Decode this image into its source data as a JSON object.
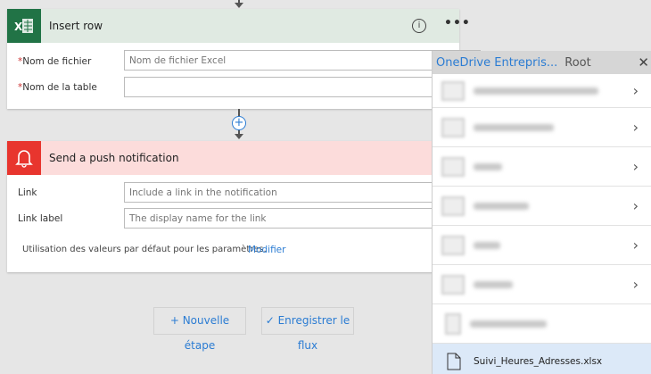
{
  "insert_row": {
    "title": "Insert row",
    "fields": [
      {
        "label": "Nom de fichier",
        "required": true,
        "placeholder": "Nom de fichier Excel"
      },
      {
        "label": "Nom de la table",
        "required": true,
        "placeholder": ""
      }
    ]
  },
  "push": {
    "title": "Send a push notification",
    "fields": [
      {
        "label": "Link",
        "placeholder": "Include a link in the notification"
      },
      {
        "label": "Link label",
        "placeholder": "The display name for the link"
      }
    ],
    "defaults_text": "Utilisation des valeurs par défaut pour les paramètres.",
    "modify_link": "Modifier"
  },
  "buttons": {
    "new_step_l1": "+ Nouvelle",
    "new_step_l2": "étape",
    "save_l1": "✓  Enregistrer le",
    "save_l2": "flux"
  },
  "picker": {
    "breadcrumb_source": "OneDrive Entrepris...",
    "breadcrumb_current": "Root",
    "selected_file": "Suivi_Heures_Adresses.xlsx"
  },
  "colors": {
    "excel": "#217346",
    "push": "#e8352e",
    "accent": "#2b7cd3"
  }
}
